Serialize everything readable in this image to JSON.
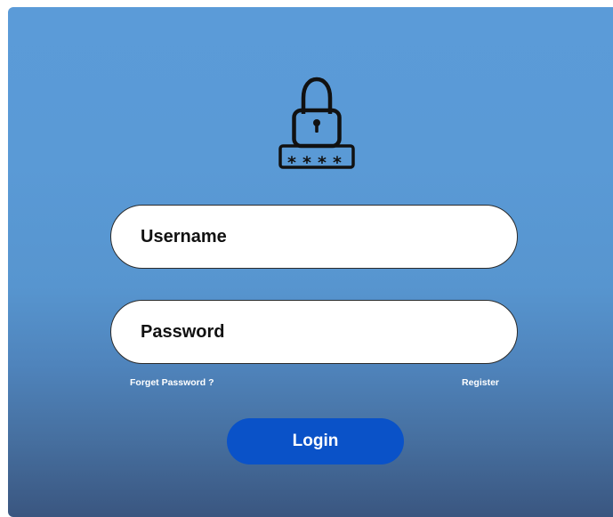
{
  "login_form": {
    "username_placeholder": "Username",
    "password_placeholder": "Password",
    "forgot_password_label": "Forget Password ?",
    "register_label": "Register",
    "login_button_label": "Login"
  },
  "icons": {
    "header_icon": "lock-with-password-icon"
  },
  "colors": {
    "gradient_top": "#5b9bd8",
    "gradient_bottom": "#3a5680",
    "field_background": "#ffffff",
    "login_button": "#0a52c8",
    "link_text": "#ffffff"
  }
}
